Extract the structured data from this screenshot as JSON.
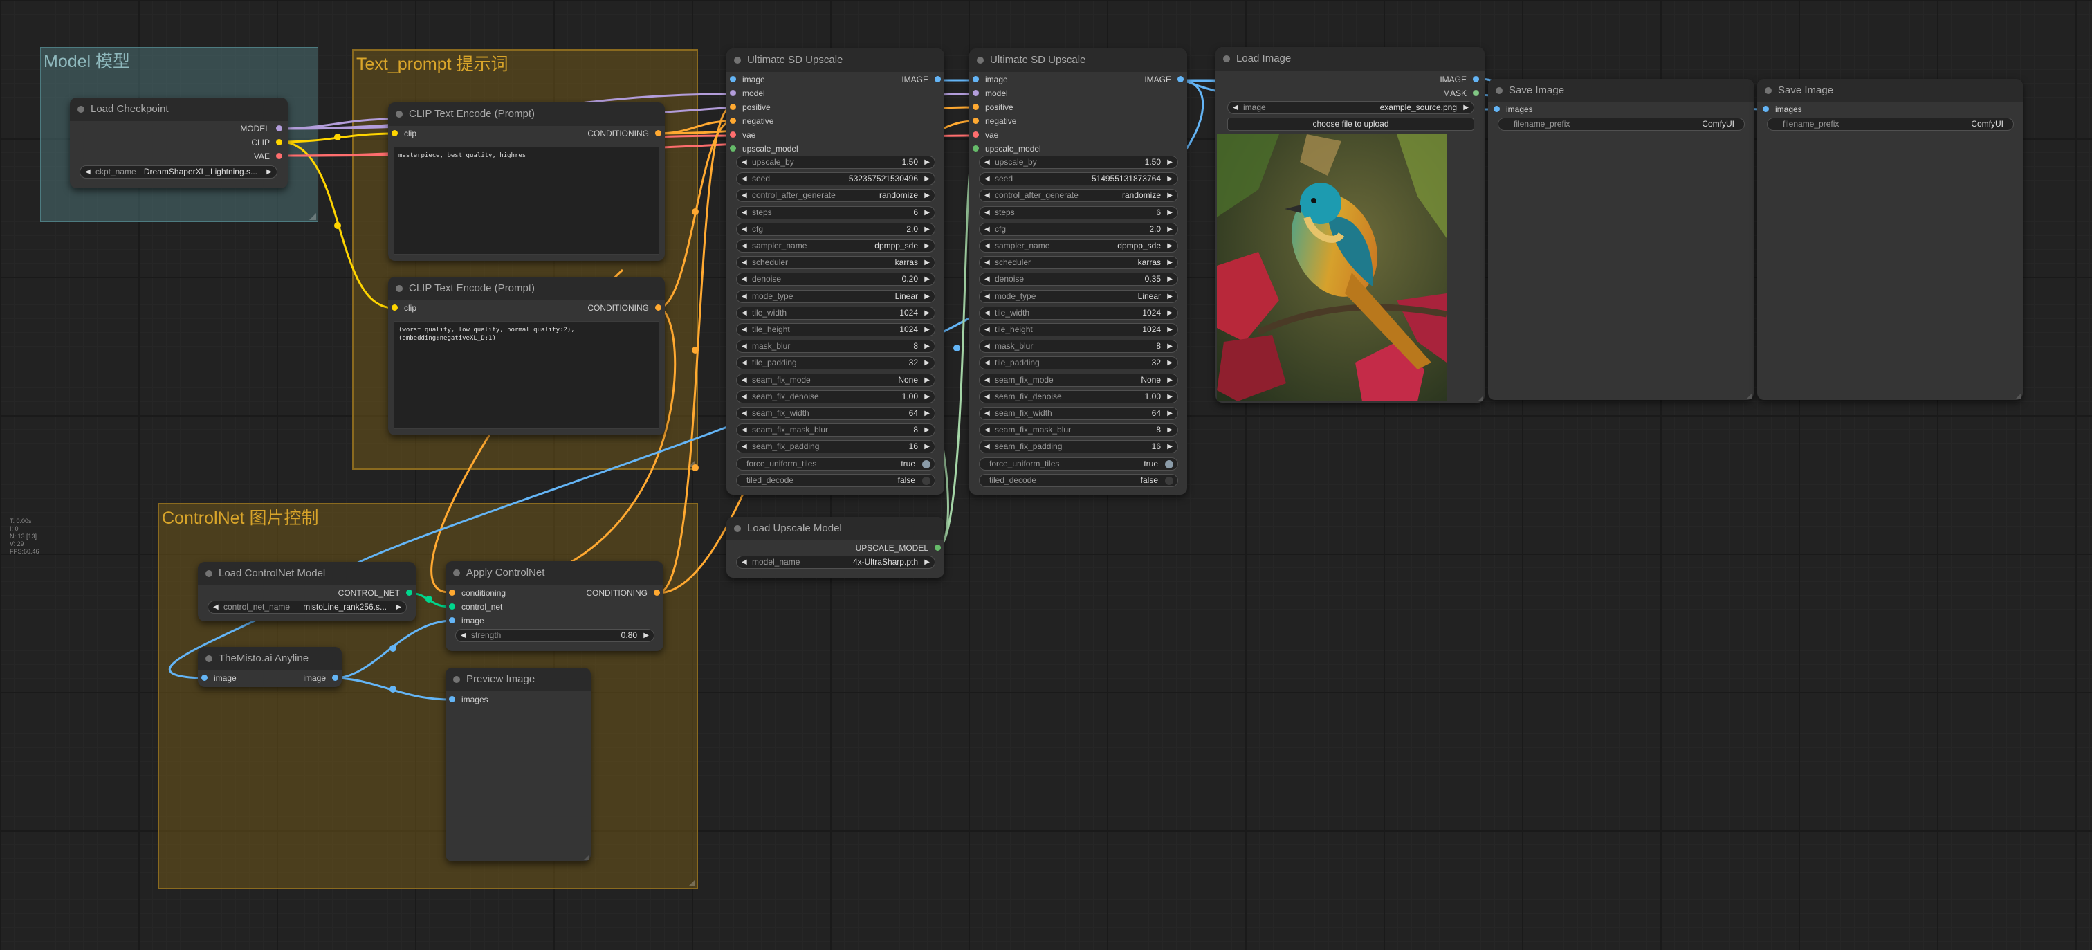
{
  "groups": {
    "model": "Model 模型",
    "prompt": "Text_prompt 提示词",
    "controlnet": "ControlNet 图片控制"
  },
  "stats": [
    "T: 0.00s",
    "I: 0",
    "N: 13 [13]",
    "V: 29",
    "FPS:60.46"
  ],
  "load_checkpoint": {
    "title": "Load Checkpoint",
    "outputs": [
      "MODEL",
      "CLIP",
      "VAE"
    ],
    "ckpt_label": "ckpt_name",
    "ckpt_value": "DreamShaperXL_Lightning.s..."
  },
  "clip_pos": {
    "title": "CLIP Text Encode (Prompt)",
    "input": "clip",
    "output": "CONDITIONING",
    "text": "masterpiece, best quality, highres"
  },
  "clip_neg": {
    "title": "CLIP Text Encode (Prompt)",
    "input": "clip",
    "output": "CONDITIONING",
    "text": "(worst quality, low quality, normal quality:2),\n(embedding:negativeXL_D:1)"
  },
  "upscale_labels": {
    "inputs": [
      "image",
      "model",
      "positive",
      "negative",
      "vae",
      "upscale_model"
    ],
    "output": "IMAGE"
  },
  "upscale1": {
    "title": "Ultimate SD Upscale",
    "widgets": [
      {
        "label": "upscale_by",
        "value": "1.50"
      },
      {
        "label": "seed",
        "value": "532357521530496"
      },
      {
        "label": "control_after_generate",
        "value": "randomize"
      },
      {
        "label": "steps",
        "value": "6"
      },
      {
        "label": "cfg",
        "value": "2.0"
      },
      {
        "label": "sampler_name",
        "value": "dpmpp_sde"
      },
      {
        "label": "scheduler",
        "value": "karras"
      },
      {
        "label": "denoise",
        "value": "0.20"
      },
      {
        "label": "mode_type",
        "value": "Linear"
      },
      {
        "label": "tile_width",
        "value": "1024"
      },
      {
        "label": "tile_height",
        "value": "1024"
      },
      {
        "label": "mask_blur",
        "value": "8"
      },
      {
        "label": "tile_padding",
        "value": "32"
      },
      {
        "label": "seam_fix_mode",
        "value": "None"
      },
      {
        "label": "seam_fix_denoise",
        "value": "1.00"
      },
      {
        "label": "seam_fix_width",
        "value": "64"
      },
      {
        "label": "seam_fix_mask_blur",
        "value": "8"
      },
      {
        "label": "seam_fix_padding",
        "value": "16"
      }
    ],
    "toggles": [
      {
        "label": "force_uniform_tiles",
        "value": "true"
      },
      {
        "label": "tiled_decode",
        "value": "false"
      }
    ]
  },
  "upscale2": {
    "title": "Ultimate SD Upscale",
    "widgets": [
      {
        "label": "upscale_by",
        "value": "1.50"
      },
      {
        "label": "seed",
        "value": "514955131873764"
      },
      {
        "label": "control_after_generate",
        "value": "randomize"
      },
      {
        "label": "steps",
        "value": "6"
      },
      {
        "label": "cfg",
        "value": "2.0"
      },
      {
        "label": "sampler_name",
        "value": "dpmpp_sde"
      },
      {
        "label": "scheduler",
        "value": "karras"
      },
      {
        "label": "denoise",
        "value": "0.35"
      },
      {
        "label": "mode_type",
        "value": "Linear"
      },
      {
        "label": "tile_width",
        "value": "1024"
      },
      {
        "label": "tile_height",
        "value": "1024"
      },
      {
        "label": "mask_blur",
        "value": "8"
      },
      {
        "label": "tile_padding",
        "value": "32"
      },
      {
        "label": "seam_fix_mode",
        "value": "None"
      },
      {
        "label": "seam_fix_denoise",
        "value": "1.00"
      },
      {
        "label": "seam_fix_width",
        "value": "64"
      },
      {
        "label": "seam_fix_mask_blur",
        "value": "8"
      },
      {
        "label": "seam_fix_padding",
        "value": "16"
      }
    ],
    "toggles": [
      {
        "label": "force_uniform_tiles",
        "value": "true"
      },
      {
        "label": "tiled_decode",
        "value": "false"
      }
    ]
  },
  "load_image": {
    "title": "Load Image",
    "outputs": [
      "IMAGE",
      "MASK"
    ],
    "image_label": "image",
    "image_value": "example_source.png",
    "upload_label": "choose file to upload"
  },
  "save1": {
    "title": "Save Image",
    "input": "images",
    "prefix_label": "filename_prefix",
    "prefix_value": "ComfyUI"
  },
  "save2": {
    "title": "Save Image",
    "input": "images",
    "prefix_label": "filename_prefix",
    "prefix_value": "ComfyUI"
  },
  "load_upscale": {
    "title": "Load Upscale Model",
    "output": "UPSCALE_MODEL",
    "label": "model_name",
    "value": "4x-UltraSharp.pth"
  },
  "load_cn": {
    "title": "Load ControlNet Model",
    "output": "CONTROL_NET",
    "label": "control_net_name",
    "value": "mistoLine_rank256.s..."
  },
  "apply_cn": {
    "title": "Apply ControlNet",
    "inputs": [
      "conditioning",
      "control_net",
      "image"
    ],
    "output": "CONDITIONING",
    "strength_label": "strength",
    "strength_value": "0.80"
  },
  "anyline": {
    "title": "TheMisto.ai Anyline",
    "input": "image",
    "output": "image"
  },
  "preview": {
    "title": "Preview Image",
    "input": "images"
  }
}
